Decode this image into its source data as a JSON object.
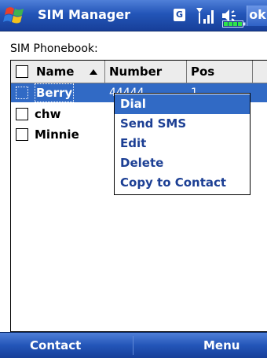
{
  "titlebar": {
    "app_title": "SIM Manager",
    "network_badge": "G",
    "ok_label": "ok",
    "icons": [
      "windows-start-icon",
      "signal-icon",
      "volume-icon",
      "battery-icon"
    ]
  },
  "section_label": "SIM Phonebook:",
  "table": {
    "columns": [
      "Name",
      "Number",
      "Pos"
    ],
    "sort": "ascending",
    "rows": [
      {
        "name": "Berry",
        "number": "44444",
        "pos": "1",
        "selected": true
      },
      {
        "name": "chw",
        "number": "",
        "pos": "",
        "selected": false
      },
      {
        "name": "Minnie",
        "number": "",
        "pos": "",
        "selected": false
      }
    ]
  },
  "context_menu": {
    "items": [
      "Dial",
      "Send SMS",
      "Edit",
      "Delete",
      "Copy to Contact"
    ],
    "active_index": 0
  },
  "softkeys": {
    "left": "Contact",
    "right": "Menu"
  },
  "colors": {
    "title_bar": "#2355b8",
    "selection": "#316ac5",
    "menu_text": "#1c3f94"
  }
}
